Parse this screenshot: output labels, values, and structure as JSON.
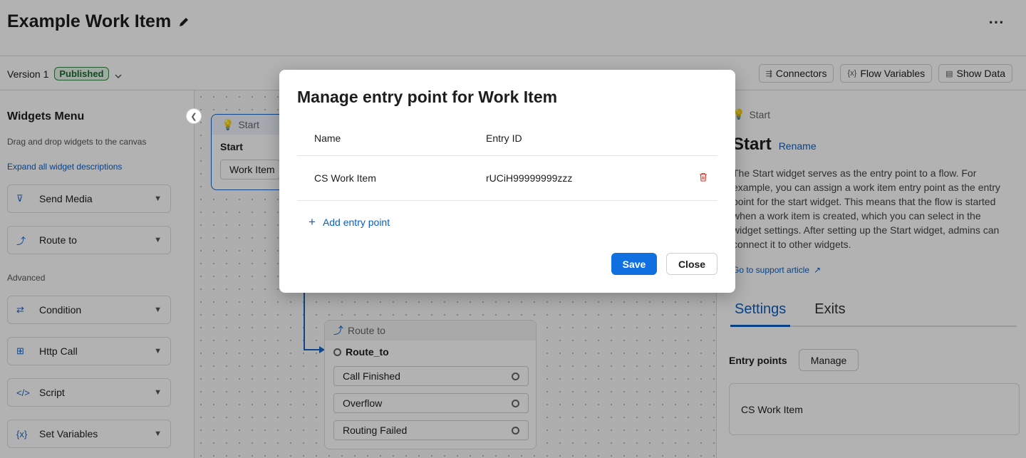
{
  "header": {
    "title": "Example Work Item",
    "more_label": "⋯"
  },
  "toolbar": {
    "version_label": "Version 1",
    "status_badge": "Published",
    "connectors_label": "Connectors",
    "flow_variables_label": "Flow Variables",
    "show_data_label": "Show Data"
  },
  "sidebar": {
    "title": "Widgets Menu",
    "subtitle": "Drag and drop widgets to the canvas",
    "expand_link": "Expand all widget descriptions",
    "advanced_label": "Advanced",
    "basic_widgets": [
      {
        "label": "Send Media",
        "icon": "send-media-icon"
      },
      {
        "label": "Route to",
        "icon": "route-icon"
      }
    ],
    "advanced_widgets": [
      {
        "label": "Condition",
        "icon": "condition-icon"
      },
      {
        "label": "Http Call",
        "icon": "http-call-icon"
      },
      {
        "label": "Script",
        "icon": "script-icon"
      },
      {
        "label": "Set Variables",
        "icon": "set-variables-icon"
      }
    ]
  },
  "canvas": {
    "start_node": {
      "header": "Start",
      "name": "Start",
      "entry": "Work Item"
    },
    "route_node": {
      "header": "Route to",
      "name": "Route_to",
      "exits": [
        "Call Finished",
        "Overflow",
        "Routing Failed"
      ]
    }
  },
  "right_panel": {
    "crumb": "Start",
    "title": "Start",
    "rename_label": "Rename",
    "description": "The Start widget serves as the entry point to a flow. For example, you can assign a work item entry point as the entry point for the start widget. This means that the flow is started when a work item is created, which you can select in the widget settings. After setting up the Start widget, admins can connect it to other widgets.",
    "support_link": "Go to support article",
    "tabs": [
      "Settings",
      "Exits"
    ],
    "entry_points_label": "Entry points",
    "manage_label": "Manage",
    "entry_value": "CS Work Item"
  },
  "modal": {
    "title": "Manage entry point for Work Item",
    "columns": [
      "Name",
      "Entry ID"
    ],
    "rows": [
      {
        "name": "CS Work Item",
        "entry_id": "rUCiH99999999zzz"
      }
    ],
    "add_label": "Add entry point",
    "save_label": "Save",
    "close_label": "Close"
  },
  "colors": {
    "accent": "#1170e0",
    "link": "#0b5fc4",
    "published": "#2e8540",
    "delete": "#d93025"
  }
}
